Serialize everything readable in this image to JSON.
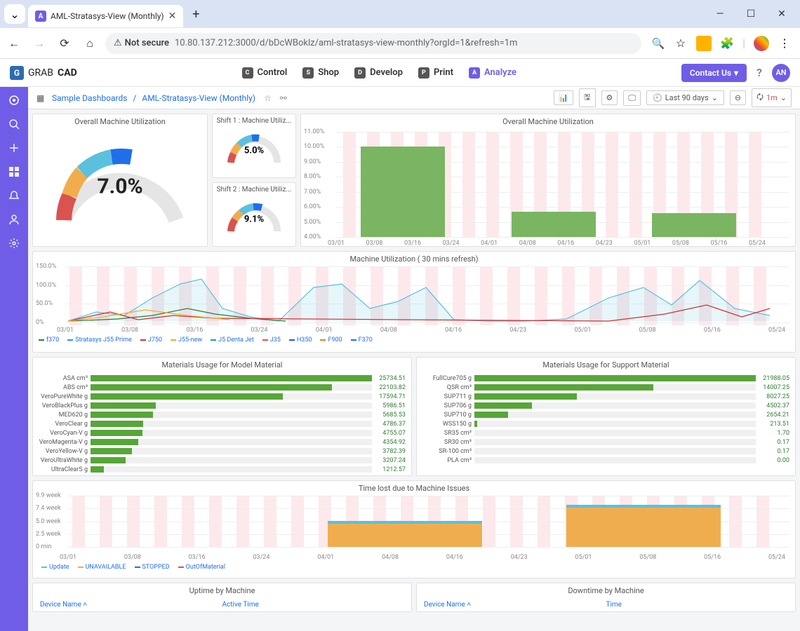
{
  "browser": {
    "tab_title": "AML-Stratasys-View (Monthly)",
    "not_secure_label": "Not secure",
    "url": "10.80.137.212:3000/d/bDcWBoklz/aml-stratasys-view-monthly?orgId=1&refresh=1m",
    "window_buttons": {
      "min": "—",
      "max": "☐",
      "close": "✕"
    }
  },
  "app": {
    "brand": "GRABCAD",
    "nav": {
      "control": "Control",
      "shop": "Shop",
      "develop": "Develop",
      "print": "Print",
      "analyze": "Analyze"
    },
    "nav_icons": {
      "control": "C",
      "shop": "S",
      "develop": "D",
      "print": "P",
      "analyze": "A"
    },
    "contact_label": "Contact Us",
    "avatar": "AN"
  },
  "dashboard": {
    "crumb_root": "Sample Dashboards",
    "crumb_sep": " / ",
    "crumb_leaf": "AML-Stratasys-View (Monthly)",
    "time_range": "Last 90 days",
    "refresh_interval": "1m"
  },
  "gauges": {
    "overall": {
      "title": "Overall Machine Utilization",
      "value": "7.0%"
    },
    "shift1": {
      "title": "Shift 1 : Machine Utiliz...",
      "value": "5.0%"
    },
    "shift2": {
      "title": "Shift 2 : Machine Utiliz...",
      "value": "9.1%"
    }
  },
  "chart_data": [
    {
      "id": "overall_util_bar",
      "title": "Overall Machine Utilization",
      "type": "bar",
      "ylabel": "%",
      "y_ticks": [
        "4.00%",
        "5.00%",
        "6.00%",
        "7.00%",
        "8.00%",
        "9.00%",
        "10.00%",
        "11.00%"
      ],
      "x_ticks": [
        "03/01",
        "03/08",
        "03/16",
        "03/24",
        "04/01",
        "04/08",
        "04/16",
        "04/23",
        "05/01",
        "05/08",
        "05/16",
        "05/24"
      ],
      "categories": [
        "2023-03",
        "2023-04",
        "2023-05"
      ],
      "values": [
        10.0,
        5.7,
        5.6
      ]
    },
    {
      "id": "util_30min",
      "title": "Machine Utilization ( 30 mins refresh)",
      "type": "line",
      "y_ticks": [
        "0%",
        "50.0%",
        "100.0%",
        "150.0%"
      ],
      "x_ticks": [
        "03/01",
        "03/08",
        "03/16",
        "03/24",
        "04/01",
        "04/08",
        "04/16",
        "04/23",
        "05/01",
        "05/08",
        "05/16",
        "05/24"
      ],
      "series_names": [
        "f370",
        "Stratasys J55 Prime",
        "J750",
        "J55-new",
        "J5 Denta Jet",
        "J35",
        "H350",
        "F900",
        "F370"
      ],
      "series_colors": [
        "#2e7d32",
        "#2196f3",
        "#d32f2f",
        "#f9a825",
        "#1fa67a",
        "#d9534f",
        "#1565c0",
        "#e67e22",
        "#1f6feb"
      ],
      "note": "multi-series sparse line chart; peaks up to ~130% around 03/10, 04/01, 05/08, 05/16"
    },
    {
      "id": "materials_model",
      "title": "Materials Usage for Model Material",
      "type": "bar",
      "orientation": "horizontal",
      "rows": [
        {
          "name": "ASA cm³",
          "val": 25734.51
        },
        {
          "name": "ABS cm³",
          "val": 22103.82
        },
        {
          "name": "VeroPureWhite g",
          "val": 17594.71
        },
        {
          "name": "VeroBlackPlus g",
          "val": 5986.51
        },
        {
          "name": "MED620 g",
          "val": 5685.53
        },
        {
          "name": "VeroClear g",
          "val": 4786.37
        },
        {
          "name": "VeroCyan-V g",
          "val": 4755.07
        },
        {
          "name": "VeroMagenta-V g",
          "val": 4354.92
        },
        {
          "name": "VeroYellow-V g",
          "val": 3782.39
        },
        {
          "name": "VeroUltraWhite g",
          "val": 3207.24
        },
        {
          "name": "UltraClearS g",
          "val": 1212.57
        }
      ],
      "max": 25734.51
    },
    {
      "id": "materials_support",
      "title": "Materials Usage for Support Material",
      "type": "bar",
      "orientation": "horizontal",
      "rows": [
        {
          "name": "FullCure705 g",
          "val": 21988.05
        },
        {
          "name": "QSR cm³",
          "val": 14007.25
        },
        {
          "name": "SUP711 g",
          "val": 8027.25
        },
        {
          "name": "SUP706 g",
          "val": 4502.37
        },
        {
          "name": "SUP710 g",
          "val": 2654.21
        },
        {
          "name": "WSS150 g",
          "val": 213.51
        },
        {
          "name": "SR35 cm³",
          "val": 1.7
        },
        {
          "name": "SR30 cm³",
          "val": 0.17
        },
        {
          "name": "SR-100 cm³",
          "val": 0.17
        },
        {
          "name": "PLA cm³",
          "val": 0
        }
      ],
      "max": 21988.05
    },
    {
      "id": "time_lost",
      "title": "Time lost due to Machine Issues",
      "type": "bar",
      "stacked": true,
      "y_ticks": [
        "0 min",
        "2.5 week",
        "5.0 week",
        "7.4 week",
        "9.9 week"
      ],
      "x_ticks": [
        "03/01",
        "03/08",
        "03/16",
        "03/24",
        "04/01",
        "04/08",
        "04/16",
        "04/23",
        "05/01",
        "05/08",
        "05/16",
        "05/24"
      ],
      "legend": [
        "Update",
        "UNAVAILABLE",
        "STOPPED",
        "OutOfMaterial"
      ],
      "legend_colors": [
        "#5bc0de",
        "#f0ad4e",
        "#1f6feb",
        "#d9534f"
      ],
      "bars": [
        {
          "month": "2023-04",
          "update": 0.5,
          "unavailable": 4.5,
          "stopped": 0,
          "out": 0
        },
        {
          "month": "2023-05",
          "update": 0.6,
          "unavailable": 7.6,
          "stopped": 0,
          "out": 0
        }
      ]
    }
  ],
  "tables": {
    "uptime": {
      "title": "Uptime by Machine",
      "cols": [
        "Device Name",
        "Active Time"
      ]
    },
    "downtime": {
      "title": "Downtime by Machine",
      "cols": [
        "Device Name",
        "Time"
      ]
    }
  }
}
